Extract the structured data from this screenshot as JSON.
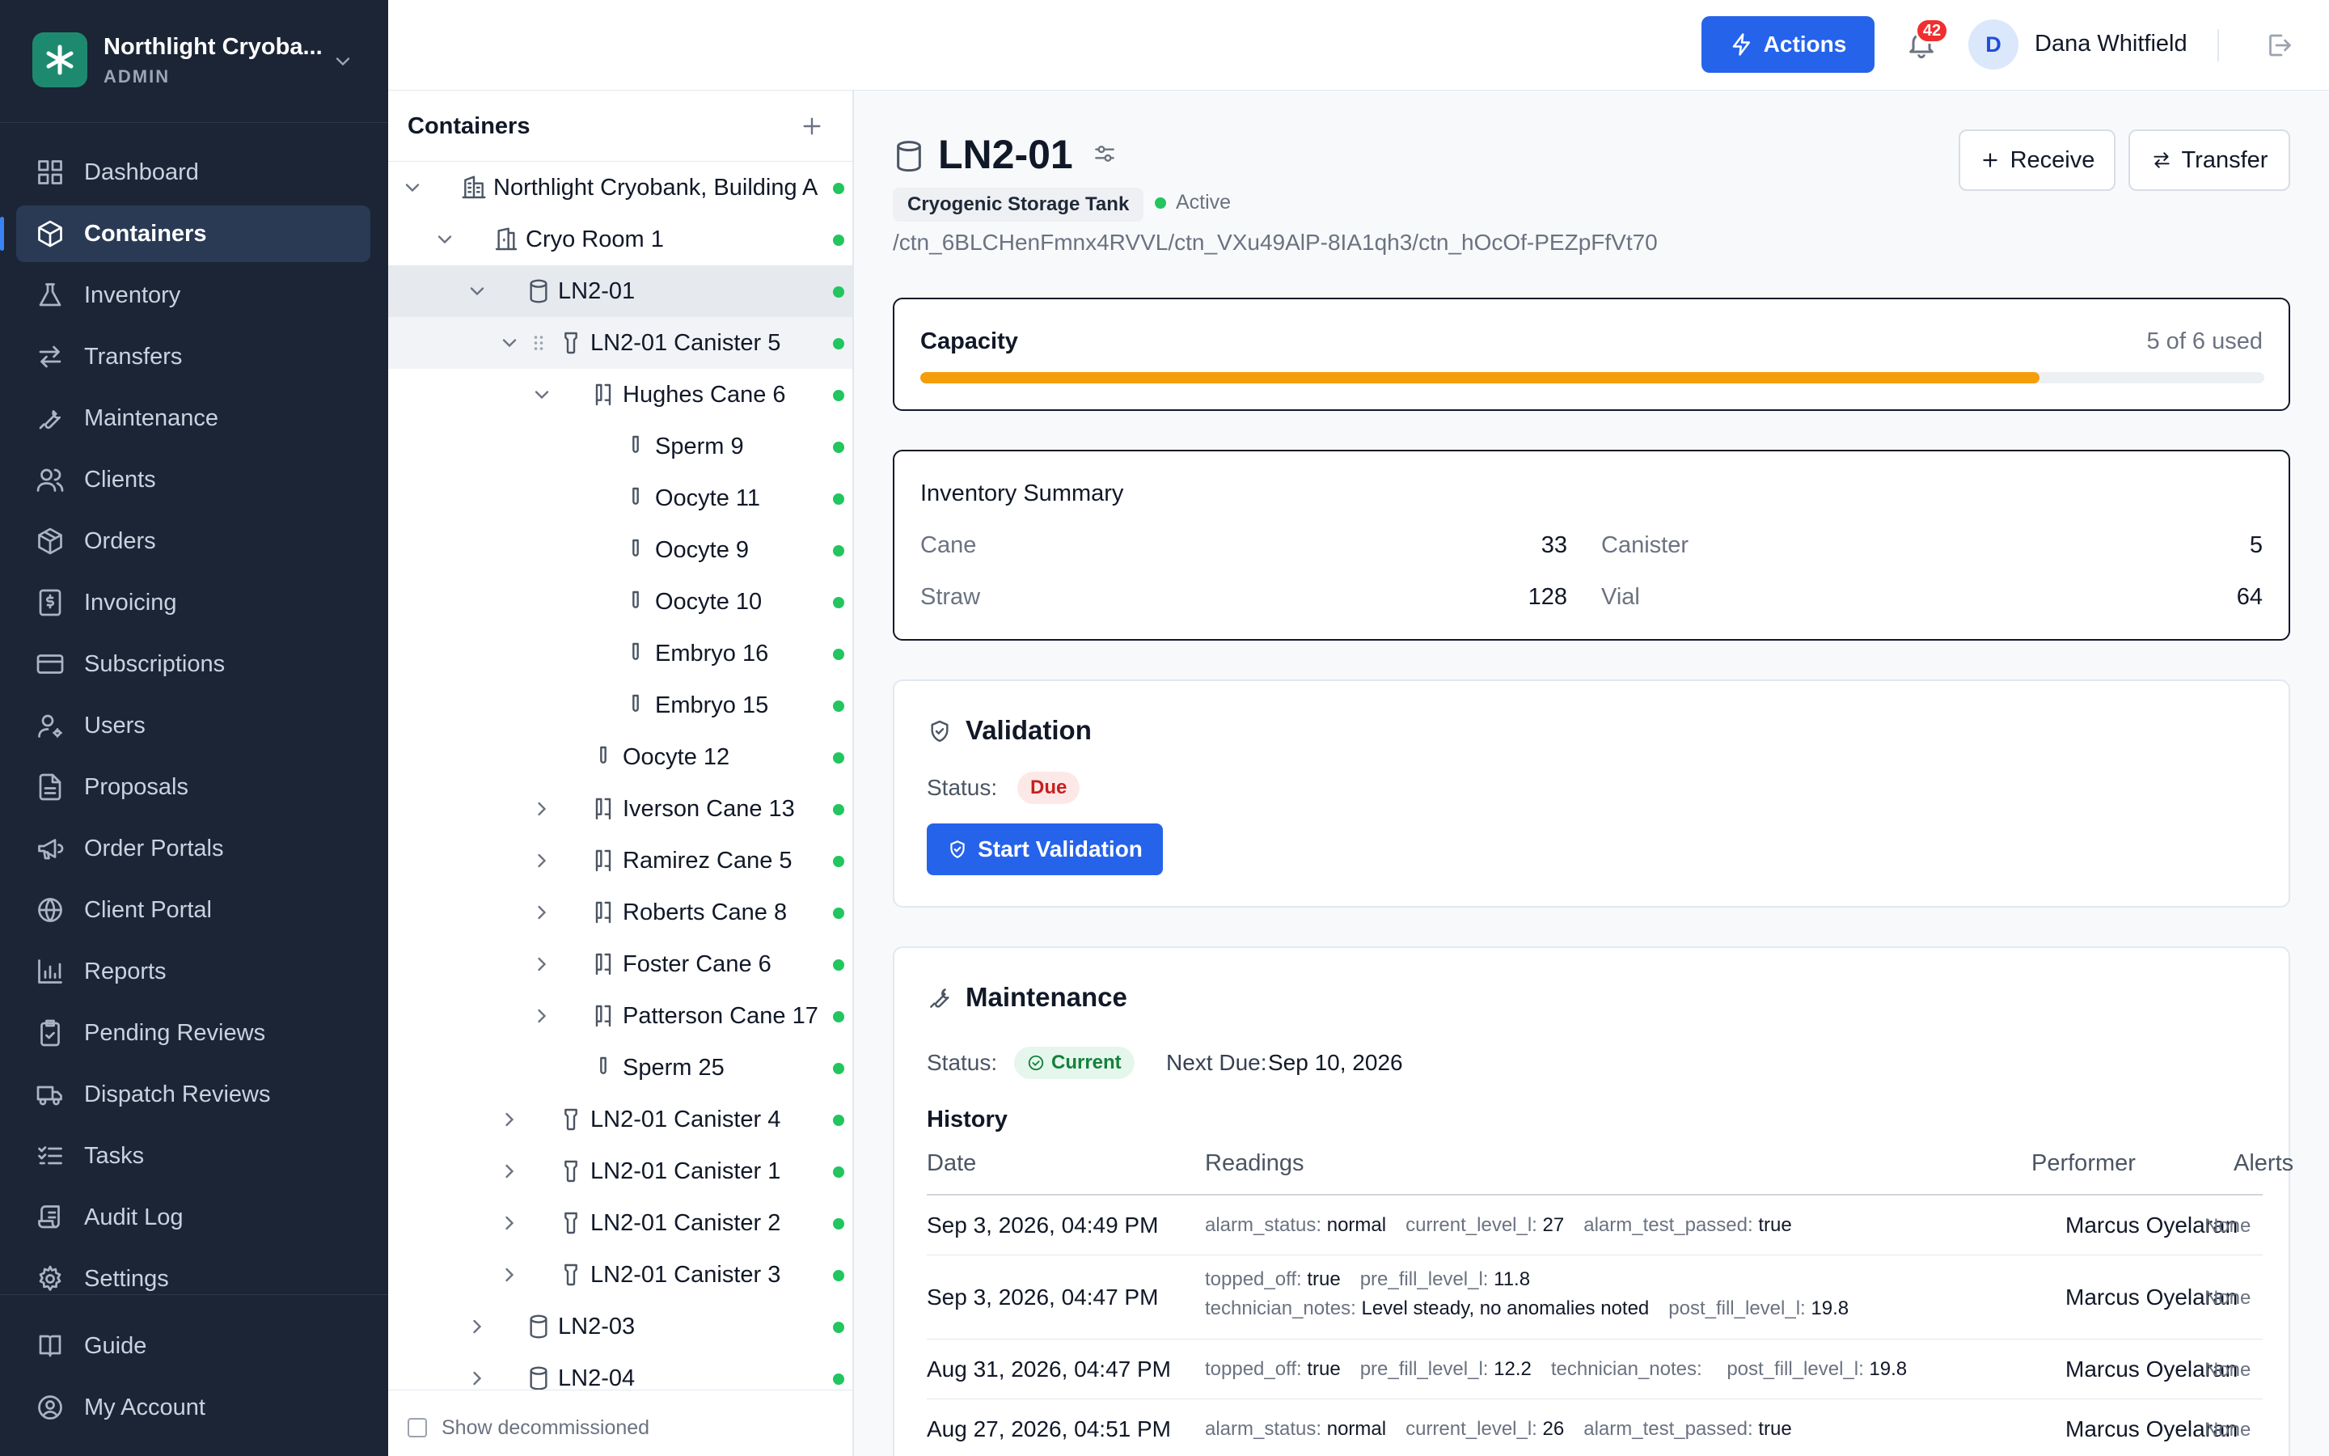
{
  "brand": {
    "name": "Northlight Cryoba...",
    "role": "ADMIN"
  },
  "nav": [
    {
      "label": "Dashboard",
      "icon": "dashboard-icon"
    },
    {
      "label": "Containers",
      "icon": "cube-icon",
      "active": true
    },
    {
      "label": "Inventory",
      "icon": "flask-icon"
    },
    {
      "label": "Transfers",
      "icon": "arrows-icon"
    },
    {
      "label": "Maintenance",
      "icon": "wrench-icon"
    },
    {
      "label": "Clients",
      "icon": "users-icon"
    },
    {
      "label": "Orders",
      "icon": "package-icon"
    },
    {
      "label": "Invoicing",
      "icon": "invoice-icon"
    },
    {
      "label": "Subscriptions",
      "icon": "card-icon"
    },
    {
      "label": "Users",
      "icon": "user-gear-icon"
    },
    {
      "label": "Proposals",
      "icon": "document-icon"
    },
    {
      "label": "Order Portals",
      "icon": "megaphone-icon"
    },
    {
      "label": "Client Portal",
      "icon": "globe-icon"
    },
    {
      "label": "Reports",
      "icon": "bar-chart-icon"
    },
    {
      "label": "Pending Reviews",
      "icon": "clipboard-check-icon"
    },
    {
      "label": "Dispatch Reviews",
      "icon": "truck-icon"
    },
    {
      "label": "Tasks",
      "icon": "list-check-icon"
    },
    {
      "label": "Audit Log",
      "icon": "scroll-icon"
    },
    {
      "label": "Settings",
      "icon": "gear-icon"
    }
  ],
  "nav_bottom": [
    {
      "label": "Guide",
      "icon": "book-icon"
    },
    {
      "label": "My Account",
      "icon": "account-icon"
    }
  ],
  "topbar": {
    "actions_label": "Actions",
    "notifications_count": "42",
    "user_initial": "D",
    "user_name": "Dana Whitfield"
  },
  "tree": {
    "title": "Containers",
    "show_decommissioned": "Show decommissioned",
    "rows": [
      {
        "label": "Northlight Cryobank, Building A",
        "level": 0,
        "chevron": "down",
        "icon": "building"
      },
      {
        "label": "Cryo Room 1",
        "level": 1,
        "chevron": "down",
        "icon": "room"
      },
      {
        "label": "LN2-01",
        "level": 2,
        "chevron": "down",
        "icon": "tank",
        "selected": true
      },
      {
        "label": "LN2-01 Canister 5",
        "level": 3,
        "chevron": "down",
        "icon": "canister",
        "hover": true
      },
      {
        "label": "Hughes Cane 6",
        "level": 4,
        "chevron": "down",
        "icon": "cane"
      },
      {
        "label": "Sperm 9",
        "level": 5,
        "chevron": "none",
        "icon": "straw"
      },
      {
        "label": "Oocyte 11",
        "level": 5,
        "chevron": "none",
        "icon": "straw"
      },
      {
        "label": "Oocyte 9",
        "level": 5,
        "chevron": "none",
        "icon": "straw"
      },
      {
        "label": "Oocyte 10",
        "level": 5,
        "chevron": "none",
        "icon": "straw"
      },
      {
        "label": "Embryo 16",
        "level": 5,
        "chevron": "none",
        "icon": "straw"
      },
      {
        "label": "Embryo 15",
        "level": 5,
        "chevron": "none",
        "icon": "straw"
      },
      {
        "label": "Oocyte 12",
        "level": 4,
        "chevron": "none",
        "icon": "straw"
      },
      {
        "label": "Iverson Cane 13",
        "level": 4,
        "chevron": "right",
        "icon": "cane"
      },
      {
        "label": "Ramirez Cane 5",
        "level": 4,
        "chevron": "right",
        "icon": "cane"
      },
      {
        "label": "Roberts Cane 8",
        "level": 4,
        "chevron": "right",
        "icon": "cane"
      },
      {
        "label": "Foster Cane 6",
        "level": 4,
        "chevron": "right",
        "icon": "cane"
      },
      {
        "label": "Patterson Cane 17",
        "level": 4,
        "chevron": "right",
        "icon": "cane"
      },
      {
        "label": "Sperm 25",
        "level": 4,
        "chevron": "none",
        "icon": "straw"
      },
      {
        "label": "LN2-01 Canister 4",
        "level": 3,
        "chevron": "right",
        "icon": "canister"
      },
      {
        "label": "LN2-01 Canister 1",
        "level": 3,
        "chevron": "right",
        "icon": "canister"
      },
      {
        "label": "LN2-01 Canister 2",
        "level": 3,
        "chevron": "right",
        "icon": "canister"
      },
      {
        "label": "LN2-01 Canister 3",
        "level": 3,
        "chevron": "right",
        "icon": "canister"
      },
      {
        "label": "LN2-03",
        "level": 2,
        "chevron": "right",
        "icon": "tank"
      },
      {
        "label": "LN2-04",
        "level": 2,
        "chevron": "right",
        "icon": "tank"
      }
    ]
  },
  "detail": {
    "title": "LN2-01",
    "type": "Cryogenic Storage Tank",
    "status": "Active",
    "path": "/ctn_6BLCHenFmnx4RVVL/ctn_VXu49AlP-8IA1qh3/ctn_hOcOf-PEZpFfVt70",
    "receive_label": "Receive",
    "transfer_label": "Transfer",
    "capacity": {
      "title": "Capacity",
      "used_text": "5 of 6 used",
      "fraction": 0.833
    },
    "inventory": {
      "title": "Inventory Summary",
      "items": [
        {
          "label": "Cane",
          "value": "33"
        },
        {
          "label": "Canister",
          "value": "5"
        },
        {
          "label": "Straw",
          "value": "128"
        },
        {
          "label": "Vial",
          "value": "64"
        }
      ]
    },
    "validation": {
      "title": "Validation",
      "status_label": "Status:",
      "status": "Due",
      "button": "Start Validation"
    },
    "maintenance": {
      "title": "Maintenance",
      "status_label": "Status:",
      "status": "Current",
      "next_due_label": "Next Due:",
      "next_due": "Sep 10, 2026",
      "history_title": "History",
      "columns": [
        "Date",
        "Readings",
        "Performer",
        "Alerts"
      ],
      "rows": [
        {
          "date": "Sep 3, 2026, 04:49 PM",
          "lines": [
            [
              [
                "alarm_status",
                "normal"
              ],
              [
                "current_level_l",
                "27"
              ],
              [
                "alarm_test_passed",
                "true"
              ]
            ]
          ],
          "performer": "Marcus Oyelaran",
          "alerts": "None"
        },
        {
          "date": "Sep 3, 2026, 04:47 PM",
          "lines": [
            [
              [
                "topped_off",
                "true"
              ],
              [
                "pre_fill_level_l",
                "11.8"
              ]
            ],
            [
              [
                "technician_notes",
                "Level steady, no anomalies noted"
              ],
              [
                "post_fill_level_l",
                "19.8"
              ]
            ]
          ],
          "performer": "Marcus Oyelaran",
          "alerts": "None"
        },
        {
          "date": "Aug 31, 2026, 04:47 PM",
          "lines": [
            [
              [
                "topped_off",
                "true"
              ],
              [
                "pre_fill_level_l",
                "12.2"
              ],
              [
                "technician_notes",
                ""
              ],
              [
                "post_fill_level_l",
                "19.8"
              ]
            ]
          ],
          "performer": "Marcus Oyelaran",
          "alerts": "None"
        },
        {
          "date": "Aug 27, 2026, 04:51 PM",
          "lines": [
            [
              [
                "alarm_status",
                "normal"
              ],
              [
                "current_level_l",
                "26"
              ],
              [
                "alarm_test_passed",
                "true"
              ]
            ]
          ],
          "performer": "Marcus Oyelaran",
          "alerts": "None"
        }
      ]
    }
  },
  "colors": {
    "sidebar_bg": "#1b2535",
    "accent": "#2563eb",
    "capacity_fill": "#f59e0b",
    "status_green": "#22c55e",
    "due_red": "#c81e1e"
  }
}
